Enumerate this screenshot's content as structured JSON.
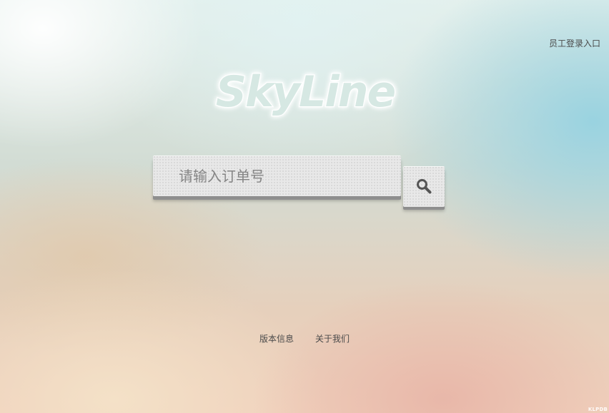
{
  "header": {
    "staff_login_label": "员工登录入口"
  },
  "logo": {
    "text": "SkyLine",
    "fill_color": "#d6e8e3",
    "outline_color": "#ffffff"
  },
  "search": {
    "placeholder": "请输入订单号",
    "value": "",
    "button_icon": "search-icon"
  },
  "footer": {
    "links": [
      {
        "label": "版本信息"
      },
      {
        "label": "关于我们"
      }
    ]
  },
  "watermark": {
    "text": "KLPDB"
  }
}
